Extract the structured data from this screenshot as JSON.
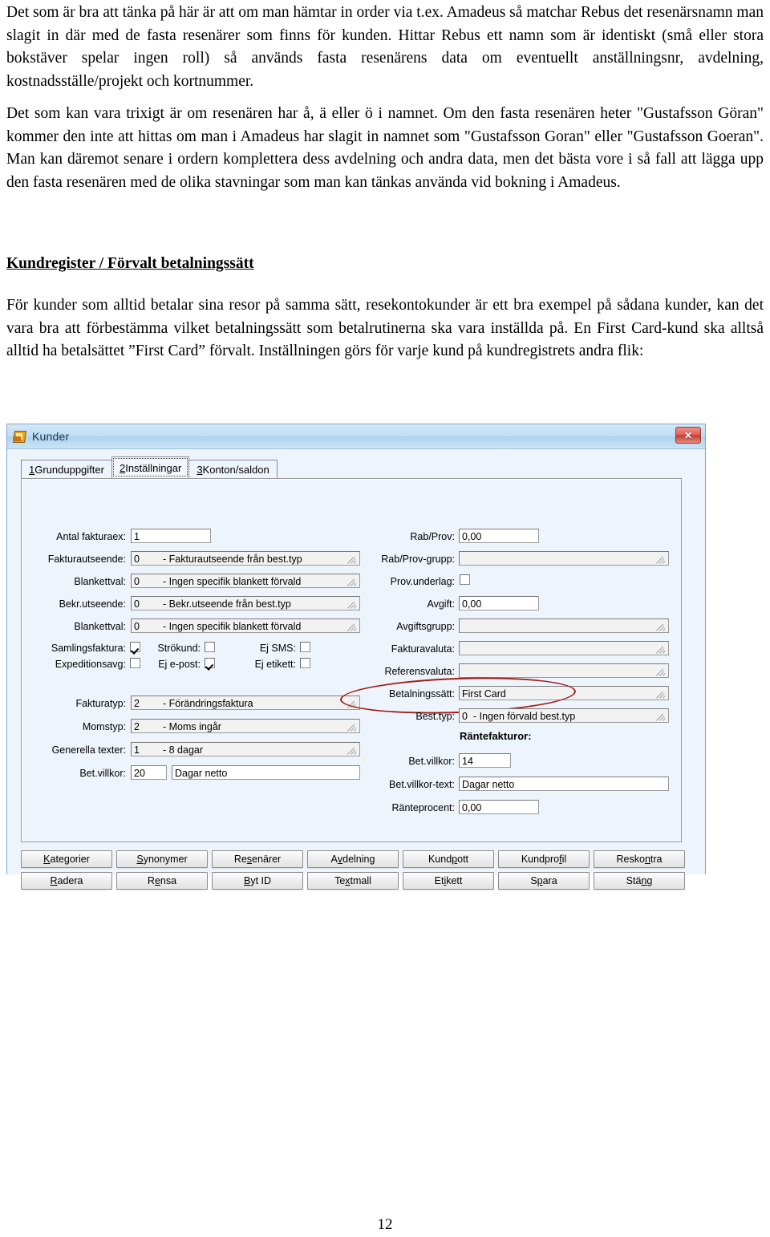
{
  "document": {
    "paragraph1": "Det som är bra att tänka på här är att om man hämtar in order via t.ex. Amadeus så matchar Rebus det resenärsnamn man slagit in där med de fasta resenärer som finns för kunden. Hittar Rebus ett namn som är identiskt (små eller stora bokstäver spelar ingen roll) så används fasta resenärens data om eventuellt anställningsnr, avdelning, kostnadsställe/projekt och kortnummer.",
    "paragraph2": "Det som kan vara trixigt är om resenären har å, ä eller ö i namnet. Om den fasta resenären heter \"Gustafsson Göran\" kommer den inte att hittas om man i Amadeus har slagit in namnet som \"Gustafsson Goran\" eller \"Gustafsson Goeran\". Man kan däremot senare i ordern komplettera dess avdelning och andra data, men det bästa vore i så fall att lägga upp den fasta resenären med de olika stavningar som man kan tänkas använda vid bokning i Amadeus.",
    "heading": "Kundregister / Förvalt betalningssätt",
    "paragraph3": "För kunder som alltid betalar sina resor på samma sätt, resekontokunder är ett bra exempel på sådana kunder, kan det vara bra att förbestämma vilket betalningssätt som betalrutinerna ska vara inställda på. En First Card-kund ska alltså alltid ha betalsättet ”First Card” förvalt. Inställningen görs för varje kund på kundregistrets andra flik:",
    "page_number": "12"
  },
  "dialog": {
    "title": "Kunder",
    "close_label": "✕",
    "tabs": [
      {
        "num": "1",
        "label": " Grunduppgifter",
        "active": false
      },
      {
        "num": "2",
        "label": " Inställningar",
        "active": true
      },
      {
        "num": "3",
        "label": " Konton/saldon",
        "active": false
      }
    ],
    "left_fields": [
      {
        "label": "Antal fakturaex:",
        "value": "1",
        "type": "text"
      },
      {
        "label": "Fakturautseende:",
        "num": "0",
        "value": "- Fakturautseende från best.typ",
        "type": "combo"
      },
      {
        "label": "Blankettval:",
        "num": "0",
        "value": "- Ingen specifik blankett förvald",
        "type": "combo"
      },
      {
        "label": "Bekr.utseende:",
        "num": "0",
        "value": "- Bekr.utseende från best.typ",
        "type": "combo"
      },
      {
        "label": "Blankettval:",
        "num": "0",
        "value": "- Ingen specifik blankett förvald",
        "type": "combo"
      }
    ],
    "checkboxes": [
      {
        "label": "Samlingsfaktura:",
        "checked": true
      },
      {
        "label": "Strökund:",
        "checked": false
      },
      {
        "label": "Ej SMS:",
        "checked": false
      },
      {
        "label": "Expeditionsavg:",
        "checked": false
      },
      {
        "label": "Ej e-post:",
        "checked": true
      },
      {
        "label": "Ej etikett:",
        "checked": false
      }
    ],
    "left_fields2": [
      {
        "label": "Fakturatyp:",
        "num": "2",
        "value": "- Förändringsfaktura",
        "type": "combo"
      },
      {
        "label": "Momstyp:",
        "num": "2",
        "value": "- Moms ingår",
        "type": "combo"
      },
      {
        "label": "Generella texter:",
        "num": "1",
        "value": "- 8 dagar",
        "type": "combo"
      }
    ],
    "bet_villkor": {
      "label": "Bet.villkor:",
      "value": "20",
      "text": "Dagar netto"
    },
    "right_fields": [
      {
        "label": "Rab/Prov:",
        "value": "0,00",
        "type": "text"
      },
      {
        "label": "Rab/Prov-grupp:",
        "value": "",
        "type": "combo"
      },
      {
        "label": "Prov.underlag:",
        "checked": false,
        "type": "checkbox"
      },
      {
        "label": "Avgift:",
        "value": "0,00",
        "type": "text"
      },
      {
        "label": "Avgiftsgrupp:",
        "value": "",
        "type": "combo"
      },
      {
        "label": "Fakturavaluta:",
        "value": "",
        "type": "combo"
      },
      {
        "label": "Referensvaluta:",
        "value": "",
        "type": "combo"
      },
      {
        "label": "Betalningssätt:",
        "value": "First Card",
        "type": "combo",
        "highlighted": true
      }
    ],
    "best_typ": {
      "label": "Best.typ:",
      "num": "0",
      "value": "- Ingen förvald best.typ"
    },
    "rantefakturor_heading": "Räntefakturor:",
    "ranta_fields": [
      {
        "label": "Bet.villkor:",
        "value": "14"
      },
      {
        "label": "Bet.villkor-text:",
        "value": "Dagar netto"
      },
      {
        "label": "Ränteprocent:",
        "value": "0,00"
      }
    ],
    "buttons_row1": [
      {
        "pre": "K",
        "post": "ategorier"
      },
      {
        "pre": "S",
        "post": "ynonymer"
      },
      {
        "pre": "Re",
        "acc": "s",
        "post": "enärer"
      },
      {
        "pre": "A",
        "acc": "v",
        "post": "delning"
      },
      {
        "pre": "Kund",
        "acc": "p",
        "post": "ott"
      },
      {
        "pre": "Kundpro",
        "acc": "f",
        "post": "il"
      },
      {
        "pre": "Resko",
        "acc": "n",
        "post": "tra"
      }
    ],
    "buttons_row2": [
      {
        "pre": "",
        "acc": "R",
        "post": "adera"
      },
      {
        "pre": "R",
        "acc": "e",
        "post": "nsa"
      },
      {
        "pre": "",
        "acc": "B",
        "post": "yt ID"
      },
      {
        "pre": "Te",
        "acc": "x",
        "post": "tmall"
      },
      {
        "pre": "Et",
        "acc": "i",
        "post": "kett"
      },
      {
        "pre": "S",
        "acc": "p",
        "post": "ara"
      },
      {
        "pre": "Stä",
        "acc": "n",
        "post": "g"
      }
    ],
    "accent_red": "#9e1f19"
  }
}
